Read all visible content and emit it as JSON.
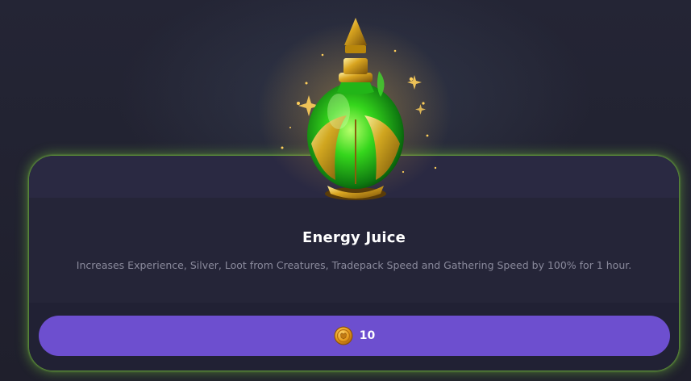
{
  "item": {
    "name": "Energy Juice",
    "description": "Increases Experience, Silver, Loot from Creatures, Tradepack Speed and Gathering Speed by 100% for 1 hour.",
    "image_icon": "green-potion-icon"
  },
  "purchase": {
    "price": "10",
    "currency_icon": "gold-coin-icon"
  },
  "colors": {
    "button": "#6d4fcf",
    "card_glow": "#78c83c",
    "potion_liquid": "#2fd11a",
    "gold": "#d9a520"
  }
}
